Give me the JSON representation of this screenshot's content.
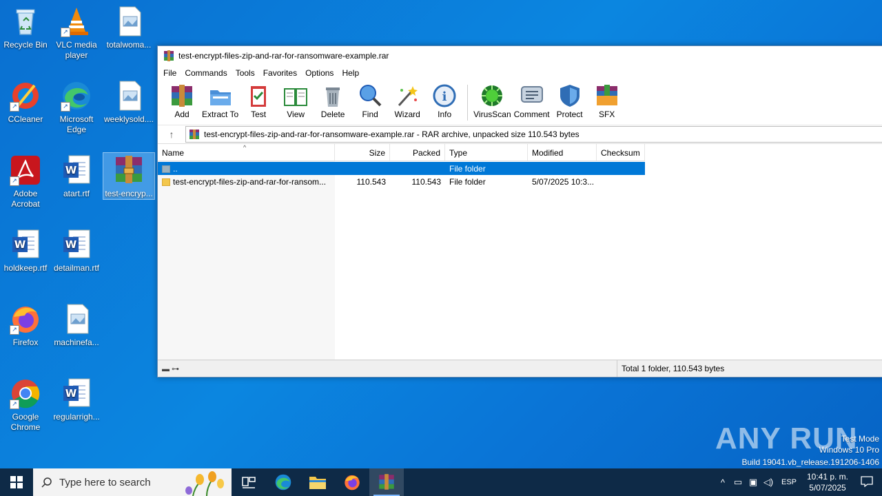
{
  "desktop": {
    "icons": [
      {
        "label": "Recycle Bin"
      },
      {
        "label": "VLC media player"
      },
      {
        "label": "totalwoma..."
      },
      {
        "label": "CCleaner"
      },
      {
        "label": "Microsoft Edge"
      },
      {
        "label": "weeklysold...."
      },
      {
        "label": "Adobe Acrobat"
      },
      {
        "label": "atart.rtf"
      },
      {
        "label": "test-encryp..."
      },
      {
        "label": "holdkeep.rtf"
      },
      {
        "label": "detailman.rtf"
      },
      {
        "label": "Firefox"
      },
      {
        "label": "machinefa..."
      },
      {
        "label": "Google Chrome"
      },
      {
        "label": "regularrigh..."
      }
    ]
  },
  "window": {
    "title": "test-encrypt-files-zip-and-rar-for-ransomware-example.rar",
    "menu": [
      "File",
      "Commands",
      "Tools",
      "Favorites",
      "Options",
      "Help"
    ],
    "toolbar": [
      "Add",
      "Extract To",
      "Test",
      "View",
      "Delete",
      "Find",
      "Wizard",
      "Info",
      "VirusScan",
      "Comment",
      "Protect",
      "SFX"
    ],
    "address": "test-encrypt-files-zip-and-rar-for-ransomware-example.rar - RAR archive, unpacked size 110.543 bytes",
    "columns": [
      "Name",
      "Size",
      "Packed",
      "Type",
      "Modified",
      "Checksum"
    ],
    "rows": [
      {
        "name": "..",
        "size": "",
        "packed": "",
        "type": "File folder",
        "modified": "",
        "checksum": ""
      },
      {
        "name": "test-encrypt-files-zip-and-rar-for-ransom...",
        "size": "110.543",
        "packed": "110.543",
        "type": "File folder",
        "modified": "5/07/2025 10:3...",
        "checksum": ""
      }
    ],
    "status": "Total 1 folder, 110.543 bytes"
  },
  "watermark": {
    "brand": "ANY RUN",
    "line1": "Test Mode",
    "line2": "Windows 10 Pro",
    "line3": "Build 19041.vb_release.191206-1406"
  },
  "taskbar": {
    "search_placeholder": "Type here to search",
    "lang": "ESP",
    "time": "10:41 p. m.",
    "date": "5/07/2025"
  }
}
